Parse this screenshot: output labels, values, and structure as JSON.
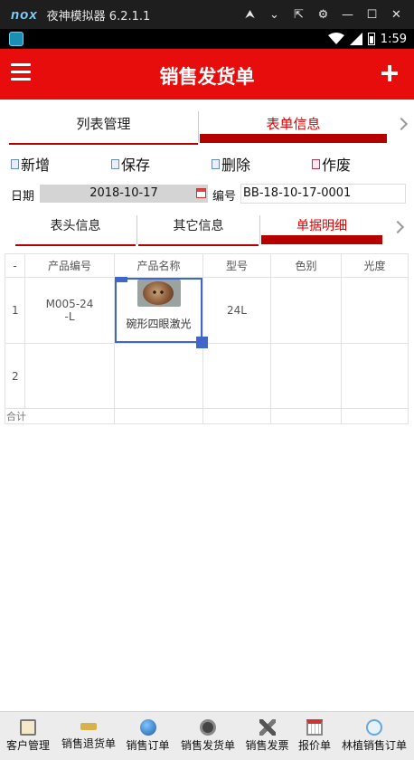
{
  "emulator": {
    "logo": "nox",
    "title": "夜神模拟器 6.2.1.1",
    "controls": [
      "⮝",
      "⌄",
      "⇱",
      "⚙",
      "—",
      "☐",
      "✕"
    ]
  },
  "status_bar": {
    "time": "1:59"
  },
  "header": {
    "title": "销售发货单",
    "menu_icon": "menu-icon",
    "add_icon": "plus-icon"
  },
  "top_tabs": [
    {
      "label": "列表管理",
      "active": false
    },
    {
      "label": "表单信息",
      "active": true
    }
  ],
  "actions": [
    {
      "label": "新增",
      "icon": "doc-new-icon"
    },
    {
      "label": "保存",
      "icon": "doc-save-icon"
    },
    {
      "label": "删除",
      "icon": "doc-delete-icon"
    },
    {
      "label": "作废",
      "icon": "doc-void-icon"
    }
  ],
  "meta": {
    "date_label": "日期",
    "date_value": "2018-10-17",
    "number_label": "编号",
    "number_value": "BB-18-10-17-0001"
  },
  "sub_tabs": [
    {
      "label": "表头信息",
      "active": false
    },
    {
      "label": "其它信息",
      "active": false
    },
    {
      "label": "单据明细",
      "active": true
    }
  ],
  "grid": {
    "columns": [
      "-",
      "产品编号",
      "产品名称",
      "型号",
      "色别",
      "光度"
    ],
    "rows": [
      {
        "num": "1",
        "code_line1": "M005-24",
        "code_line2": "-L",
        "name": "碗形四眼激光",
        "model": "24L",
        "color": "",
        "gloss": ""
      },
      {
        "num": "2",
        "code_line1": "",
        "code_line2": "",
        "name": "",
        "model": "",
        "color": "",
        "gloss": ""
      }
    ],
    "summary_label": "合计"
  },
  "bottom_nav": [
    {
      "label": "客户管理",
      "icon": "clipboard-icon"
    },
    {
      "label": "销售退货单",
      "icon": "sign-icon"
    },
    {
      "label": "销售订单",
      "icon": "globe-icon"
    },
    {
      "label": "销售发货单",
      "icon": "film-reel-icon"
    },
    {
      "label": "销售发票",
      "icon": "tools-icon"
    },
    {
      "label": "报价单",
      "icon": "calendar-icon"
    },
    {
      "label": "林植销售订单",
      "icon": "compass-icon"
    }
  ]
}
